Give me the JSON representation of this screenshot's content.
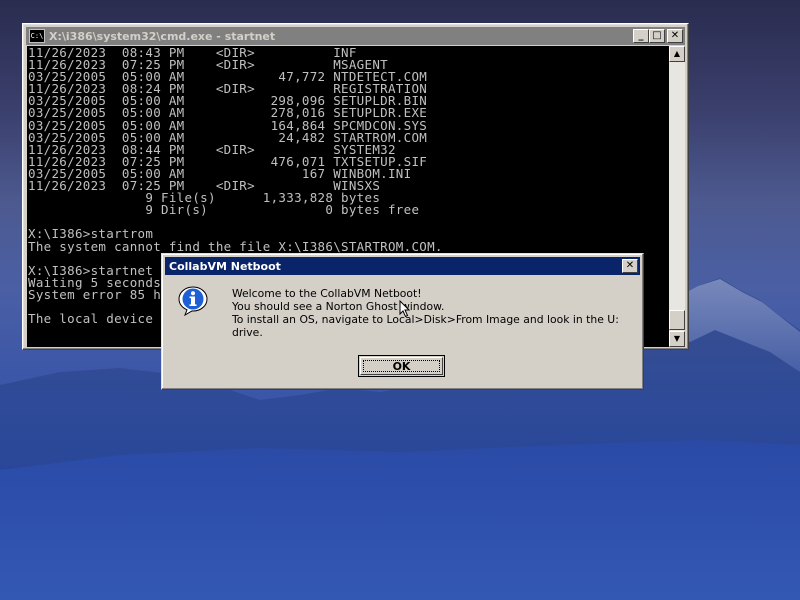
{
  "colors": {
    "console_bg": "#000000",
    "console_text": "#c0c0c0",
    "dialog_title_active": "#0a246a",
    "window_title_inactive": "#808080",
    "window_face": "#d4d0c8"
  },
  "cmd_window": {
    "title": "X:\\i386\\system32\\cmd.exe - startnet",
    "icon": "cmd-icon",
    "icon_text": "C:\\",
    "buttons": {
      "minimize": "_",
      "maximize": "□",
      "close": "✕"
    },
    "console_lines": [
      "11/26/2023  08:43 PM    <DIR>          INF",
      "11/26/2023  07:25 PM    <DIR>          MSAGENT",
      "03/25/2005  05:00 AM            47,772 NTDETECT.COM",
      "11/26/2023  08:24 PM    <DIR>          REGISTRATION",
      "03/25/2005  05:00 AM           298,096 SETUPLDR.BIN",
      "03/25/2005  05:00 AM           278,016 SETUPLDR.EXE",
      "03/25/2005  05:00 AM           164,864 SPCMDCON.SYS",
      "03/25/2005  05:00 AM            24,482 STARTROM.COM",
      "11/26/2023  08:44 PM    <DIR>          SYSTEM32",
      "11/26/2023  07:25 PM           476,071 TXTSETUP.SIF",
      "03/25/2005  05:00 AM               167 WINBOM.INI",
      "11/26/2023  07:25 PM    <DIR>          WINSXS",
      "               9 File(s)      1,333,828 bytes",
      "               9 Dir(s)               0 bytes free",
      "",
      "X:\\I386>startrom",
      "The system cannot find the file X:\\I386\\STARTROM.COM.",
      "",
      "X:\\I386>startnet",
      "Waiting 5 seconds",
      "System error 85 h",
      "",
      "The local device"
    ],
    "scrollbar": {
      "up": "▲",
      "down": "▼"
    }
  },
  "dialog": {
    "title": "CollabVM Netboot",
    "close": "✕",
    "icon": "info-icon",
    "message_lines": [
      "Welcome to the CollabVM Netboot!",
      "You should see a Norton Ghost window.",
      "To install an OS, navigate to Local>Disk>From Image and look in the U: drive."
    ],
    "ok_label": "OK"
  }
}
